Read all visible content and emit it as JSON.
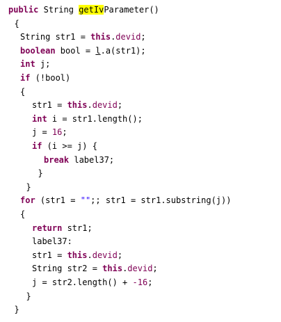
{
  "editor": {
    "lines": [
      {
        "indent": 0,
        "parts": [
          {
            "t": "public",
            "c": "kw"
          },
          {
            "t": " "
          },
          {
            "t": "String",
            "c": ""
          },
          {
            "t": " "
          },
          {
            "t": "getIv",
            "c": "hl"
          },
          {
            "t": "Parameter()"
          }
        ]
      },
      {
        "indent": 1,
        "parts": [
          {
            "t": "{"
          }
        ]
      },
      {
        "indent": 2,
        "parts": [
          {
            "t": "String str1 = "
          },
          {
            "t": "this",
            "c": "kw"
          },
          {
            "t": "."
          },
          {
            "t": "devid",
            "c": "fld"
          },
          {
            "t": ";"
          }
        ]
      },
      {
        "indent": 2,
        "parts": [
          {
            "t": "boolean",
            "c": "kw"
          },
          {
            "t": " bool = "
          },
          {
            "t": "l",
            "c": "ul"
          },
          {
            "t": ".a(str1);"
          }
        ]
      },
      {
        "indent": 2,
        "parts": [
          {
            "t": "int",
            "c": "kw"
          },
          {
            "t": " j;"
          }
        ]
      },
      {
        "indent": 2,
        "parts": [
          {
            "t": "if",
            "c": "kw"
          },
          {
            "t": " (!bool)"
          }
        ]
      },
      {
        "indent": 2,
        "parts": [
          {
            "t": "{"
          }
        ]
      },
      {
        "indent": 4,
        "parts": [
          {
            "t": "str1 = "
          },
          {
            "t": "this",
            "c": "kw"
          },
          {
            "t": "."
          },
          {
            "t": "devid",
            "c": "fld"
          },
          {
            "t": ";"
          }
        ]
      },
      {
        "indent": 4,
        "parts": [
          {
            "t": "int",
            "c": "kw"
          },
          {
            "t": " i = str1.length();"
          }
        ]
      },
      {
        "indent": 4,
        "parts": [
          {
            "t": "j = "
          },
          {
            "t": "16",
            "c": "num"
          },
          {
            "t": ";"
          }
        ]
      },
      {
        "indent": 4,
        "parts": [
          {
            "t": "if",
            "c": "kw"
          },
          {
            "t": " (i >= j) {"
          }
        ]
      },
      {
        "indent": 6,
        "parts": [
          {
            "t": "break",
            "c": "kw"
          },
          {
            "t": " label37;"
          }
        ]
      },
      {
        "indent": 5,
        "parts": [
          {
            "t": "}"
          }
        ]
      },
      {
        "indent": 3,
        "parts": [
          {
            "t": "}"
          }
        ]
      },
      {
        "indent": 2,
        "parts": [
          {
            "t": "for",
            "c": "kw"
          },
          {
            "t": " (str1 = "
          },
          {
            "t": "\"\"",
            "c": "str"
          },
          {
            "t": ";; str1 = str1.substring(j))"
          }
        ]
      },
      {
        "indent": 2,
        "parts": [
          {
            "t": "{"
          }
        ]
      },
      {
        "indent": 4,
        "parts": [
          {
            "t": "return",
            "c": "kw"
          },
          {
            "t": " str1;"
          }
        ]
      },
      {
        "indent": 4,
        "parts": [
          {
            "t": "label37:"
          }
        ]
      },
      {
        "indent": 4,
        "parts": [
          {
            "t": "str1 = "
          },
          {
            "t": "this",
            "c": "kw"
          },
          {
            "t": "."
          },
          {
            "t": "devid",
            "c": "fld"
          },
          {
            "t": ";"
          }
        ]
      },
      {
        "indent": 4,
        "parts": [
          {
            "t": "String str2 = "
          },
          {
            "t": "this",
            "c": "kw"
          },
          {
            "t": "."
          },
          {
            "t": "devid",
            "c": "fld"
          },
          {
            "t": ";"
          }
        ]
      },
      {
        "indent": 4,
        "parts": [
          {
            "t": "j = str2.length() + "
          },
          {
            "t": "-16",
            "c": "num"
          },
          {
            "t": ";"
          }
        ]
      },
      {
        "indent": 3,
        "parts": [
          {
            "t": "}"
          }
        ]
      },
      {
        "indent": 1,
        "parts": [
          {
            "t": "}"
          }
        ]
      }
    ]
  }
}
